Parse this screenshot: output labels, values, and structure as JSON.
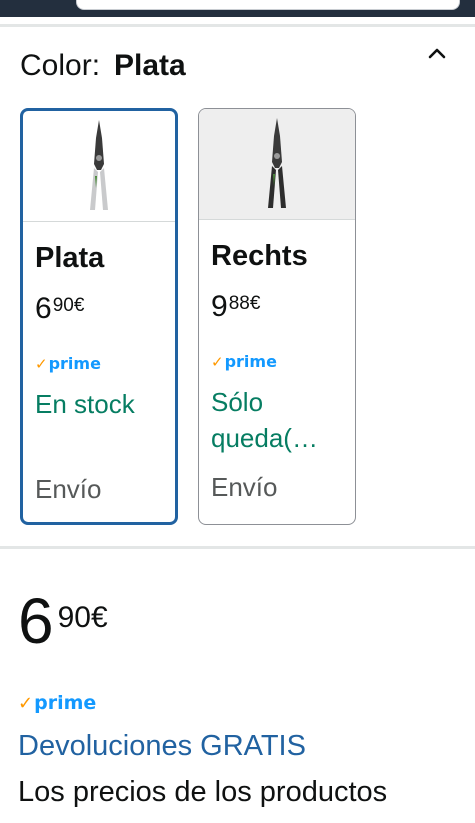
{
  "color_selector": {
    "label": "Color:",
    "selected_value": "Plata",
    "collapse_icon": "chevron-up-icon"
  },
  "variants": [
    {
      "name": "Plata",
      "price_whole": "6",
      "price_fraction": "90€",
      "prime_label": "prime",
      "availability": "En stock",
      "shipping": "Envío",
      "selected": true
    },
    {
      "name": "Rechts",
      "price_whole": "9",
      "price_fraction": "88€",
      "prime_label": "prime",
      "availability": "Sólo queda(…",
      "shipping": "Envío",
      "selected": false
    }
  ],
  "buybox": {
    "price_whole": "6",
    "price_fraction": "90€",
    "prime_label": "prime",
    "returns_link": "Devoluciones GRATIS",
    "disclaimer": "Los precios de los productos"
  },
  "colors": {
    "accent_link": "#2162a1",
    "in_stock": "#067d62",
    "prime_blue": "#1399ff",
    "prime_check": "#ff9900",
    "header": "#232f3e"
  }
}
